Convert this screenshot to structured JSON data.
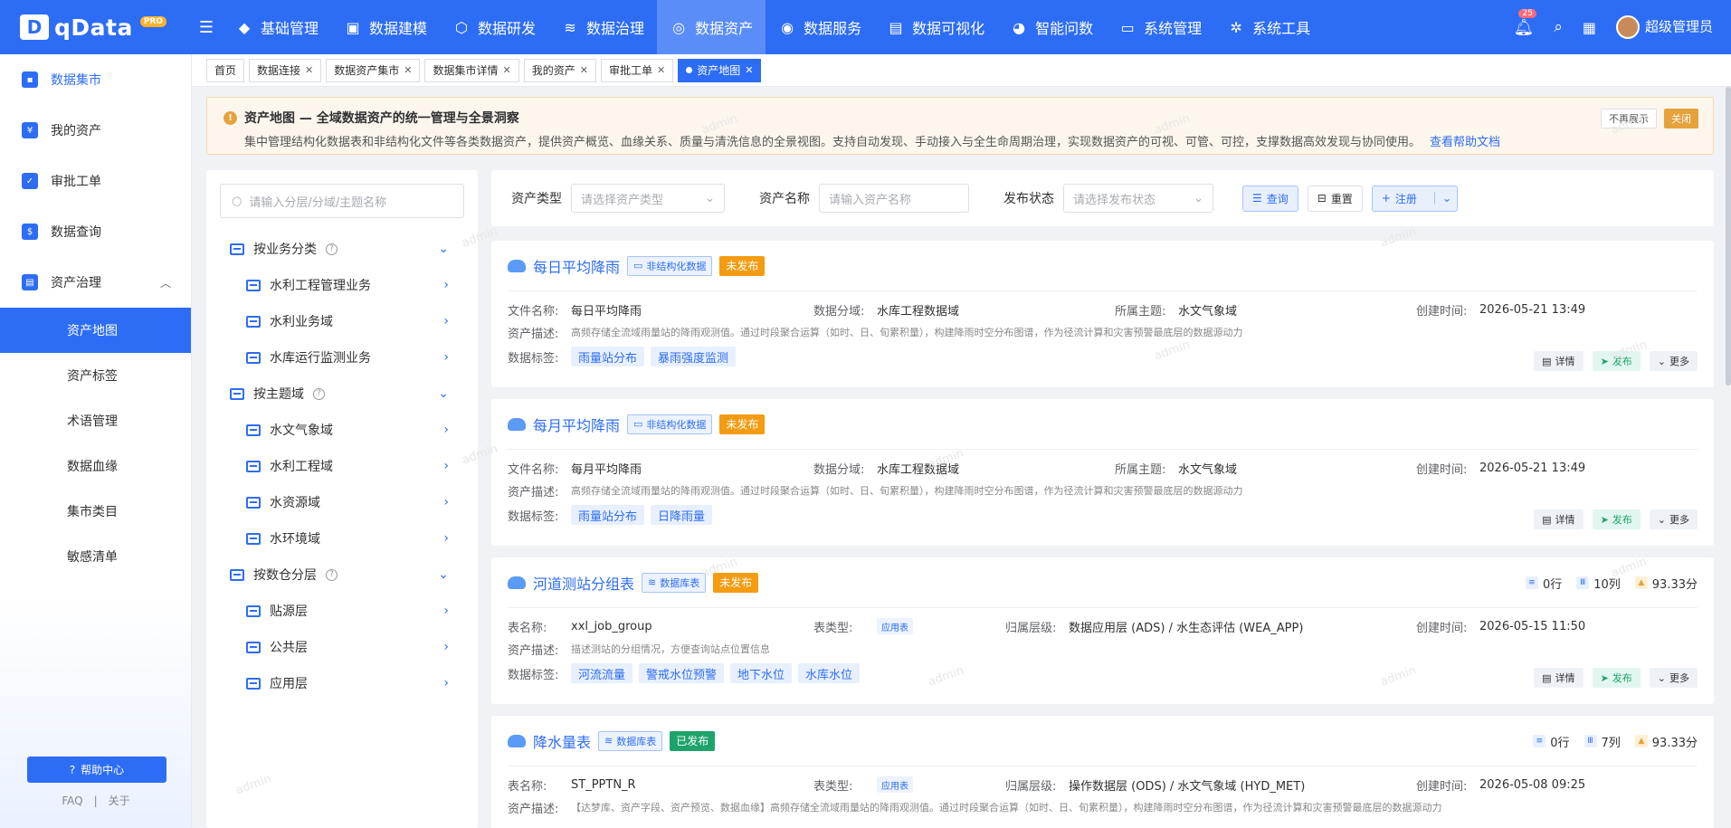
{
  "app": {
    "name": "qData",
    "badge": "PRO"
  },
  "topnav": {
    "items": [
      {
        "label": "基础管理",
        "icon": "cube-icon"
      },
      {
        "label": "数据建模",
        "icon": "book-icon"
      },
      {
        "label": "数据研发",
        "icon": "box-icon"
      },
      {
        "label": "数据治理",
        "icon": "database-icon"
      },
      {
        "label": "数据资产",
        "icon": "target-icon",
        "active": true
      },
      {
        "label": "数据服务",
        "icon": "service-icon"
      },
      {
        "label": "数据可视化",
        "icon": "chart-icon"
      },
      {
        "label": "智能问数",
        "icon": "chat-icon"
      },
      {
        "label": "系统管理",
        "icon": "monitor-icon"
      },
      {
        "label": "系统工具",
        "icon": "gear-icon"
      }
    ],
    "bell_count": "25",
    "user": "超级管理员"
  },
  "sidebar": {
    "items": [
      {
        "label": "数据集市"
      },
      {
        "label": "我的资产"
      },
      {
        "label": "审批工单"
      },
      {
        "label": "数据查询"
      },
      {
        "label": "资产治理"
      }
    ],
    "subitems": [
      "资产地图",
      "资产标签",
      "术语管理",
      "数据血缘",
      "集市类目",
      "敏感清单"
    ],
    "help": "帮助中心",
    "faq": "FAQ",
    "sep": "|",
    "about": "关于"
  },
  "tabs": [
    "首页",
    "数据连接",
    "数据资产集市",
    "数据集市详情",
    "我的资产",
    "审批工单",
    "资产地图"
  ],
  "notice": {
    "title": "资产地图 — 全域数据资产的统一管理与全景洞察",
    "text": "集中管理结构化数据表和非结构化文件等各类数据资产，提供资产概览、血缘关系、质量与清洗信息的全景视图。支持自动发现、手动接入与全生命周期治理，实现数据资产的可视、可管、可控，支撑数据高效发现与协同使用。",
    "link": "查看帮助文档",
    "hide": "不再展示",
    "close": "关闭"
  },
  "tree": {
    "search_placeholder": "请输入分层/分域/主题名称",
    "groups": [
      {
        "label": "按业务分类",
        "children": [
          "水利工程管理业务",
          "水利业务域",
          "水库运行监测业务"
        ]
      },
      {
        "label": "按主题域",
        "children": [
          "水文气象域",
          "水利工程域",
          "水资源域",
          "水环境域"
        ]
      },
      {
        "label": "按数仓分层",
        "children": [
          "贴源层",
          "公共层",
          "应用层"
        ]
      }
    ]
  },
  "filters": {
    "type_label": "资产类型",
    "type_placeholder": "请选择资产类型",
    "name_label": "资产名称",
    "name_placeholder": "请输入资产名称",
    "status_label": "发布状态",
    "status_placeholder": "请选择发布状态",
    "query": "查询",
    "reset": "重置",
    "register": "注册"
  },
  "labels": {
    "file_name": "文件名称:",
    "table_name": "表名称:",
    "domain": "数据分域:",
    "theme": "所属主题:",
    "created": "创建时间:",
    "desc": "资产描述:",
    "tags": "数据标签:",
    "table_type": "表类型:",
    "layer": "归属层级:",
    "detail": "详情",
    "publish": "发布",
    "more": "更多"
  },
  "cards": [
    {
      "title": "每日平均降雨",
      "type": "非结构化数据",
      "status": "未发布",
      "name": "每日平均降雨",
      "domain": "水库工程数据域",
      "theme": "水文气象域",
      "created": "2026-05-21 13:49",
      "desc": "高频存储全流域雨量站的降雨观测值。通过时段聚合运算（如时、日、旬累积量），构建降雨时空分布图谱，作为径流计算和灾害预警最底层的数据源动力",
      "tags": [
        "雨量站分布",
        "暴雨强度监测"
      ]
    },
    {
      "title": "每月平均降雨",
      "type": "非结构化数据",
      "status": "未发布",
      "name": "每月平均降雨",
      "domain": "水库工程数据域",
      "theme": "水文气象域",
      "created": "2026-05-21 13:49",
      "desc": "高频存储全流域雨量站的降雨观测值。通过时段聚合运算（如时、日、旬累积量），构建降雨时空分布图谱，作为径流计算和灾害预警最底层的数据源动力",
      "tags": [
        "雨量站分布",
        "日降雨量"
      ]
    },
    {
      "title": "河道测站分组表",
      "type": "数据库表",
      "status": "未发布",
      "name": "xxl_job_group",
      "table_type": "应用表",
      "layer": "数据应用层 (ADS) / 水生态评估 (WEA_APP)",
      "created": "2026-05-15 11:50",
      "desc": "描述测站的分组情况，方便查询站点位置信息",
      "tags": [
        "河流流量",
        "警戒水位预警",
        "地下水位",
        "水库水位"
      ],
      "rows": "0行",
      "cols": "10列",
      "score": "93.33分"
    },
    {
      "title": "降水量表",
      "type": "数据库表",
      "status": "已发布",
      "name": "ST_PPTN_R",
      "table_type": "应用表",
      "layer": "操作数据层 (ODS) / 水文气象域 (HYD_MET)",
      "created": "2026-05-08 09:25",
      "desc": "【达梦库、资产字段、资产预览、数据血缘】高频存储全流域雨量站的降雨观测值。通过时段聚合运算（如时、日、旬累积量），构建降雨时空分布图谱，作为径流计算和灾害预警最底层的数据源动力",
      "rows": "0行",
      "cols": "7列",
      "score": "93.33分"
    }
  ],
  "watermark": "admin"
}
